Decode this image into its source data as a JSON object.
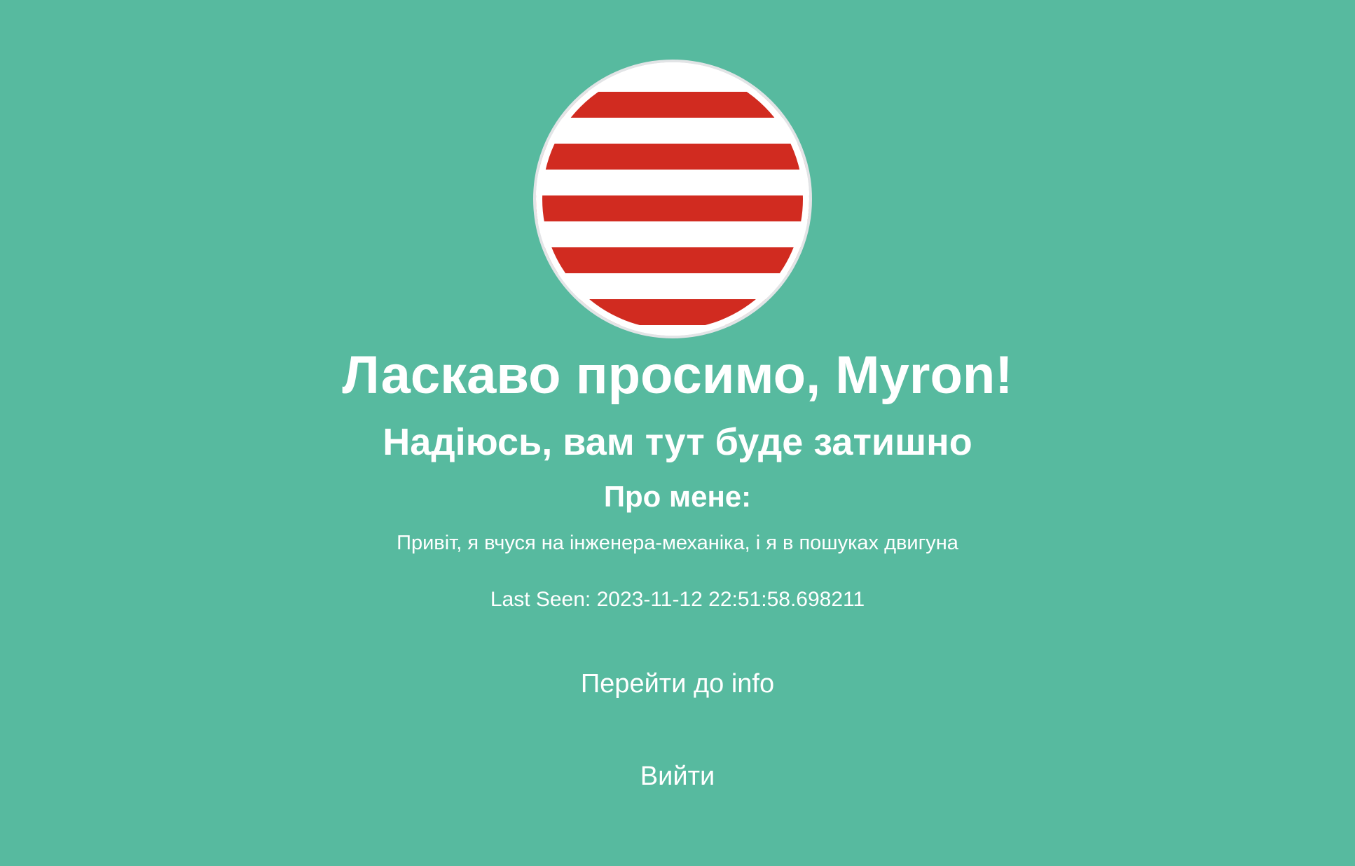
{
  "colors": {
    "background": "#57BA9F",
    "text": "#FFFFFF",
    "avatar_stripe": "#D12B20",
    "avatar_border": "#E2E4E6"
  },
  "avatar": {
    "icon": "red-white-striped-circle-avatar"
  },
  "welcome": {
    "title": "Ласкаво просимо, Myron!",
    "subtitle": "Надіюсь, вам тут буде затишно"
  },
  "about": {
    "heading": "Про мене:",
    "bio": "Привіт, я вчуся на інженера-механіка, і я в пошуках двигуна"
  },
  "last_seen": "Last Seen: 2023-11-12 22:51:58.698211",
  "links": {
    "info_label": "Перейти до info",
    "logout_label": "Вийти"
  }
}
